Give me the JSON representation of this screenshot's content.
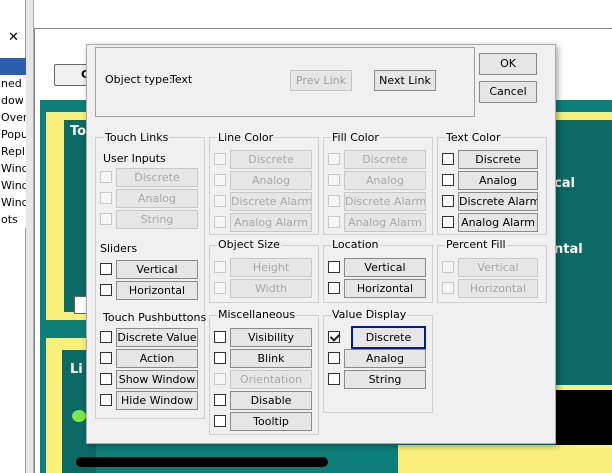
{
  "background": {
    "close_label": "✕",
    "list_items": [
      "",
      "ned",
      "dow",
      "Over",
      "Popu",
      "Repl",
      "Wind",
      "Wind",
      "Wind",
      "ots"
    ],
    "c_button": "C",
    "text_to": "To",
    "text_cal": "cal",
    "text_ntal": "ntal",
    "text_li": "Li"
  },
  "dialog": {
    "object_type_label": "Object type:",
    "object_type_value": "Text",
    "prev_link": "Prev Link",
    "next_link": "Next Link",
    "ok": "OK",
    "cancel": "Cancel",
    "touch_links": "Touch Links",
    "user_inputs": {
      "title": "User Inputs",
      "items": [
        "Discrete",
        "Analog",
        "String"
      ]
    },
    "sliders": {
      "title": "Sliders",
      "items": [
        "Vertical",
        "Horizontal"
      ]
    },
    "touch_pushbuttons": {
      "title": "Touch Pushbuttons",
      "items": [
        "Discrete Value",
        "Action",
        "Show Window",
        "Hide Window"
      ]
    },
    "line_color": {
      "title": "Line Color",
      "items": [
        "Discrete",
        "Analog",
        "Discrete Alarm",
        "Analog Alarm"
      ]
    },
    "fill_color": {
      "title": "Fill Color",
      "items": [
        "Discrete",
        "Analog",
        "Discrete Alarm",
        "Analog Alarm"
      ]
    },
    "text_color": {
      "title": "Text Color",
      "items": [
        "Discrete",
        "Analog",
        "Discrete Alarm",
        "Analog Alarm"
      ]
    },
    "object_size": {
      "title": "Object Size",
      "items": [
        "Height",
        "Width"
      ]
    },
    "location": {
      "title": "Location",
      "items": [
        "Vertical",
        "Horizontal"
      ]
    },
    "percent_fill": {
      "title": "Percent Fill",
      "items": [
        "Vertical",
        "Horizontal"
      ]
    },
    "miscellaneous": {
      "title": "Miscellaneous",
      "items": [
        "Visibility",
        "Blink",
        "Orientation",
        "Disable",
        "Tooltip"
      ]
    },
    "value_display": {
      "title": "Value Display",
      "items": [
        "Discrete",
        "Analog",
        "String"
      ]
    }
  }
}
